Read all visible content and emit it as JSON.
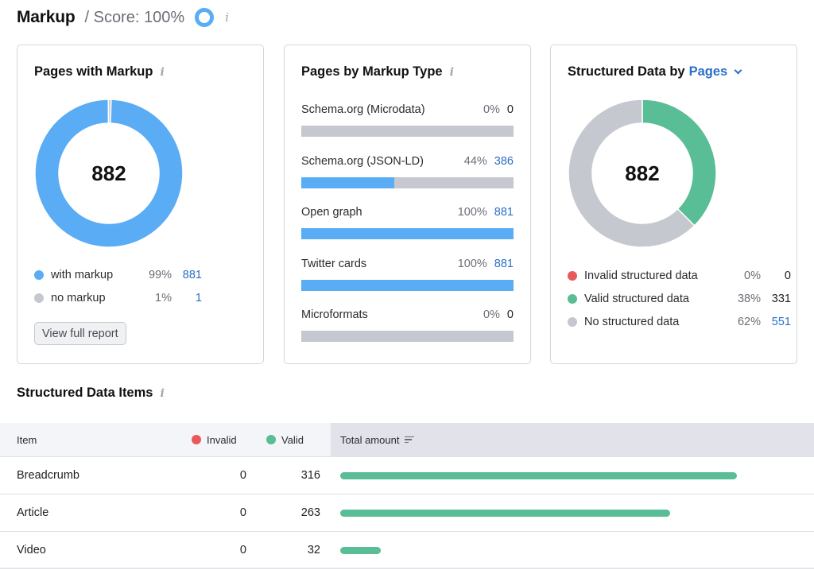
{
  "header": {
    "title": "Markup",
    "score_label": "/ Score: 100%",
    "score_percent": 100,
    "score_ring_color": "#5aacf5",
    "info_icon": "i"
  },
  "colors": {
    "blue": "#5aacf5",
    "gray": "#c5c8ce",
    "green": "#59bd95",
    "red": "#e85a5a",
    "link": "#2a6fc9"
  },
  "pages_with_markup": {
    "title": "Pages with Markup",
    "info_icon": "i",
    "total": "882",
    "legend": [
      {
        "label": "with markup",
        "percent": "99%",
        "value": "881",
        "value_link": true,
        "color": "#5aacf5"
      },
      {
        "label": "no markup",
        "percent": "1%",
        "value": "1",
        "value_link": true,
        "color": "#c5c8ce"
      }
    ],
    "button_label": "View full report"
  },
  "pages_by_markup_type": {
    "title": "Pages by Markup Type",
    "info_icon": "i",
    "items": [
      {
        "name": "Schema.org (Microdata)",
        "percent": "0%",
        "value": "0",
        "value_link": false,
        "fraction": 0
      },
      {
        "name": "Schema.org (JSON-LD)",
        "percent": "44%",
        "value": "386",
        "value_link": true,
        "fraction": 0.44
      },
      {
        "name": "Open graph",
        "percent": "100%",
        "value": "881",
        "value_link": true,
        "fraction": 1.0
      },
      {
        "name": "Twitter cards",
        "percent": "100%",
        "value": "881",
        "value_link": true,
        "fraction": 1.0
      },
      {
        "name": "Microformats",
        "percent": "0%",
        "value": "0",
        "value_link": false,
        "fraction": 0
      }
    ]
  },
  "structured_data_by": {
    "title_prefix": "Structured Data by",
    "selector_value": "Pages",
    "total": "882",
    "legend": [
      {
        "label": "Invalid structured data",
        "percent": "0%",
        "value": "0",
        "value_link": false,
        "color": "#e85a5a"
      },
      {
        "label": "Valid structured data",
        "percent": "38%",
        "value": "331",
        "value_link": false,
        "color": "#59bd95"
      },
      {
        "label": "No structured data",
        "percent": "62%",
        "value": "551",
        "value_link": true,
        "color": "#c5c8ce"
      }
    ]
  },
  "structured_data_items": {
    "title": "Structured Data Items",
    "info_icon": "i",
    "columns": {
      "item": "Item",
      "invalid": "Invalid",
      "valid": "Valid",
      "total": "Total amount"
    },
    "max_total": 316,
    "rows": [
      {
        "item": "Breadcrumb",
        "invalid": "0",
        "valid": "316",
        "total": 316
      },
      {
        "item": "Article",
        "invalid": "0",
        "valid": "263",
        "total": 263
      },
      {
        "item": "Video",
        "invalid": "0",
        "valid": "32",
        "total": 32
      }
    ]
  },
  "chart_data": [
    {
      "type": "pie",
      "title": "Pages with Markup",
      "center_label": "882",
      "categories": [
        "with markup",
        "no markup"
      ],
      "values": [
        881,
        1
      ]
    },
    {
      "type": "bar",
      "title": "Pages by Markup Type",
      "categories": [
        "Schema.org (Microdata)",
        "Schema.org (JSON-LD)",
        "Open graph",
        "Twitter cards",
        "Microformats"
      ],
      "values": [
        0,
        386,
        881,
        881,
        0
      ],
      "percent": [
        0,
        44,
        100,
        100,
        0
      ]
    },
    {
      "type": "pie",
      "title": "Structured Data by Pages",
      "center_label": "882",
      "categories": [
        "Invalid structured data",
        "Valid structured data",
        "No structured data"
      ],
      "values": [
        0,
        331,
        551
      ]
    },
    {
      "type": "bar",
      "title": "Structured Data Items",
      "categories": [
        "Breadcrumb",
        "Article",
        "Video"
      ],
      "series": [
        {
          "name": "Invalid",
          "values": [
            0,
            0,
            0
          ]
        },
        {
          "name": "Valid",
          "values": [
            316,
            263,
            32
          ]
        }
      ]
    }
  ]
}
